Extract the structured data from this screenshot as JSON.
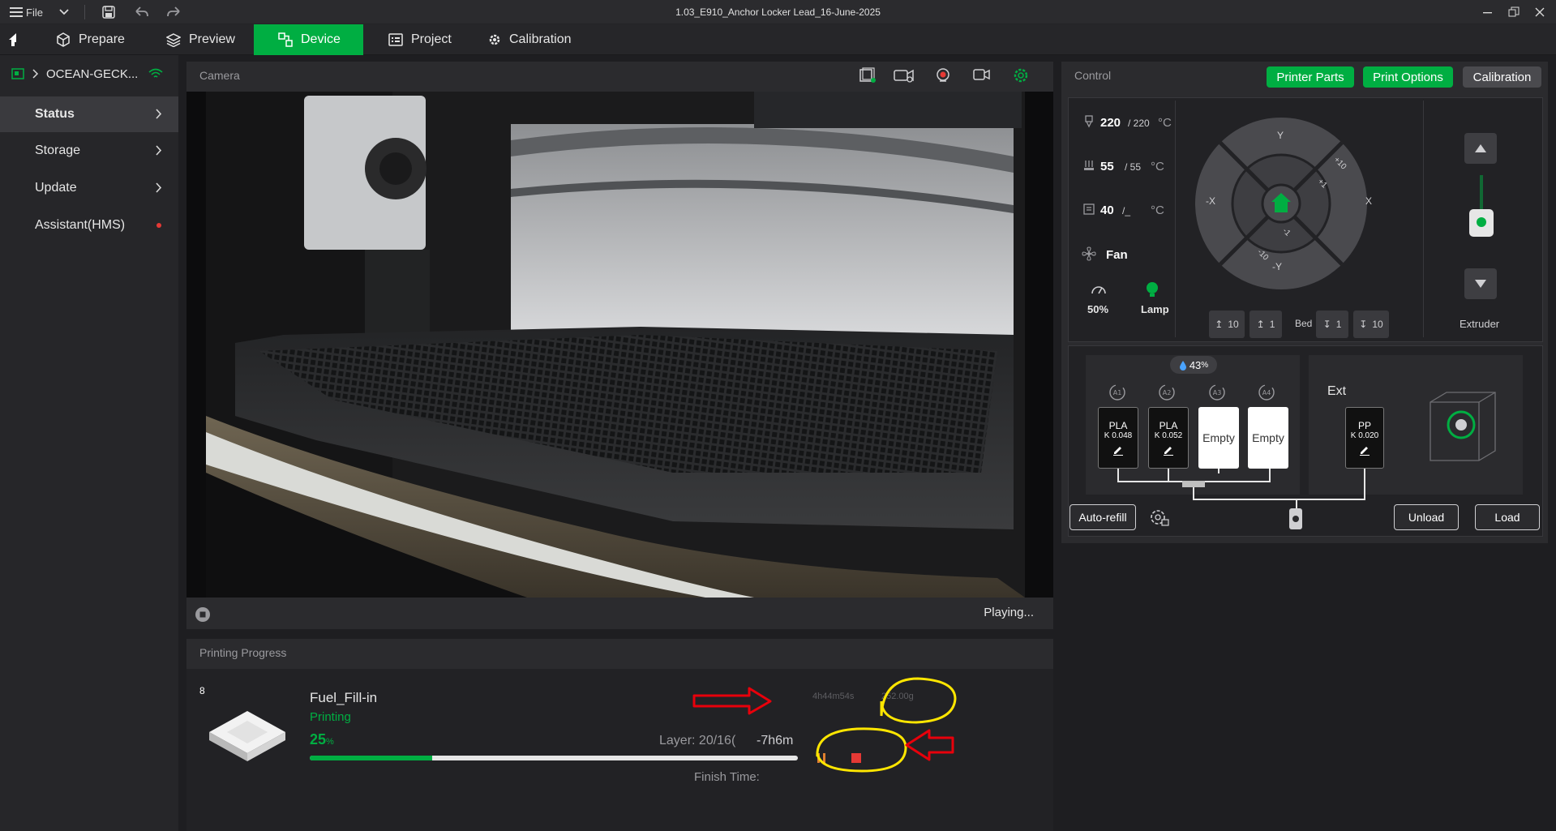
{
  "window": {
    "title": "1.03_E910_Anchor Locker Lead_16-June-2025",
    "file_menu": "File"
  },
  "tabs": [
    {
      "label": "Prepare"
    },
    {
      "label": "Preview"
    },
    {
      "label": "Device"
    },
    {
      "label": "Project"
    },
    {
      "label": "Calibration"
    }
  ],
  "sidebar": {
    "device_name": "OCEAN-GECK...",
    "items": [
      {
        "label": "Status"
      },
      {
        "label": "Storage"
      },
      {
        "label": "Update"
      },
      {
        "label": "Assistant(HMS)"
      }
    ]
  },
  "camera": {
    "title": "Camera",
    "status": "Playing..."
  },
  "progress": {
    "title": "Printing Progress",
    "plate_number": "8",
    "job_name": "Fuel_Fill-in",
    "state": "Printing",
    "percent": "25",
    "percent_unit": "%",
    "percent_value": 0.25,
    "elapsed": "4h44m54s",
    "weight": "252.00g",
    "layer_label": "Layer: 20/16(",
    "remaining": "-7h6m",
    "finish_label": "Finish Time:"
  },
  "control": {
    "title": "Control",
    "btn_printer_parts": "Printer Parts",
    "btn_print_options": "Print Options",
    "btn_calibration": "Calibration",
    "nozzle_temp": "220",
    "nozzle_target": "/ 220",
    "bed_temp": "55",
    "bed_target": "/ 55",
    "chamber_temp": "40",
    "chamber_target": "/_",
    "temp_unit": "°C",
    "fan_label": "Fan",
    "speed_value": "50%",
    "lamp_label": "Lamp",
    "jog": {
      "y": "Y",
      "neg_y": "-Y",
      "x": "X",
      "neg_x": "-X",
      "p10": "+10",
      "p1": "+1",
      "m1": "-1",
      "m10": "-10"
    },
    "bed_label": "Bed",
    "bed_steps": [
      "10",
      "1",
      "1",
      "10"
    ],
    "extruder_label": "Extruder",
    "humidity": "43",
    "humidity_unit": "%",
    "slots": [
      {
        "id": "A1",
        "type": "PLA",
        "k": "K 0.048"
      },
      {
        "id": "A2",
        "type": "PLA",
        "k": "K 0.052"
      },
      {
        "id": "A3",
        "type": "Empty"
      },
      {
        "id": "A4",
        "type": "Empty"
      }
    ],
    "ext_label": "Ext",
    "ext_slot": {
      "type": "PP",
      "k": "K 0.020"
    },
    "btn_auto_refill": "Auto-refill",
    "btn_unload": "Unload",
    "btn_load": "Load"
  },
  "colors": {
    "accent": "#00ae42",
    "annotation_red": "#e8000b",
    "annotation_yellow": "#ffe600"
  }
}
